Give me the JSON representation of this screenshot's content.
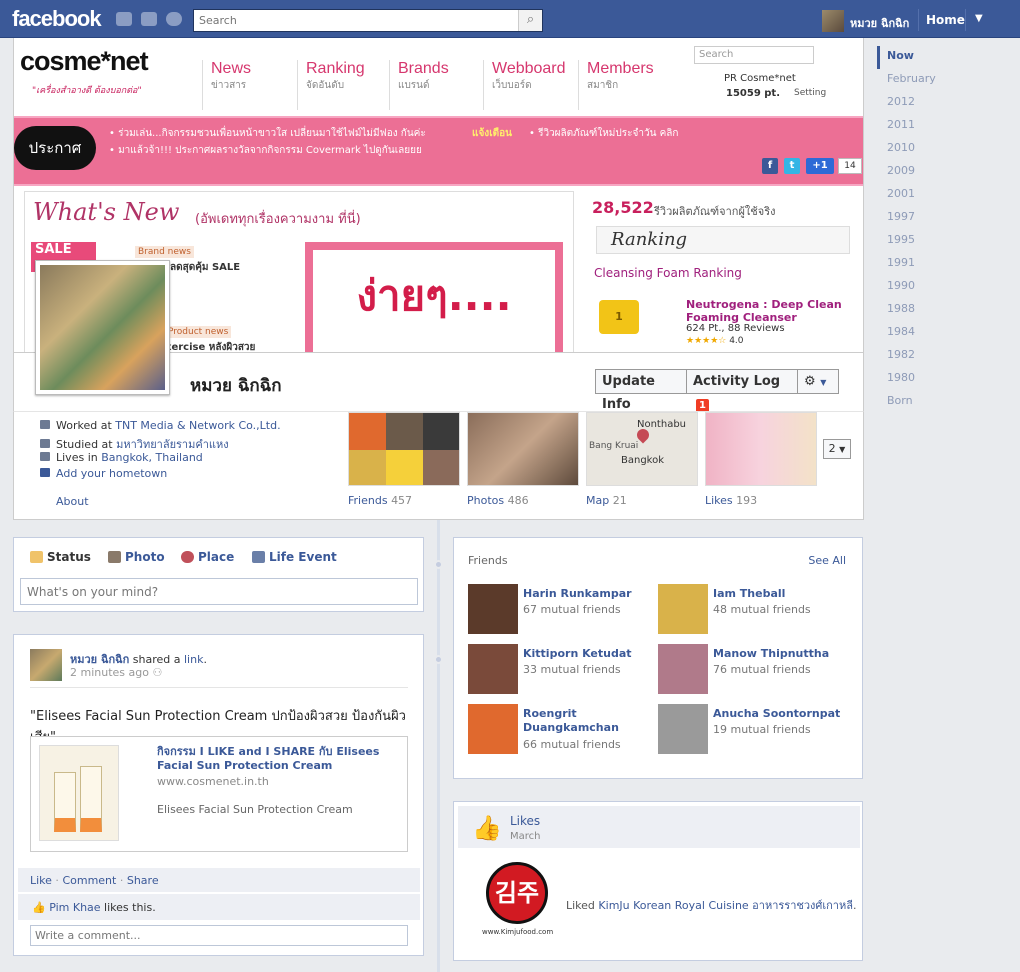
{
  "topbar": {
    "logo": "facebook",
    "search_placeholder": "Search",
    "user_name": "หมวย ฉิกฉิก",
    "home": "Home",
    "menu_arrow": "▼"
  },
  "cosme": {
    "logo": "cosme*net",
    "tagline": "\"เครื่องสำอางดี ต้องบอกต่อ\"",
    "nav": [
      {
        "en": "News",
        "th": "ข่าวสาร"
      },
      {
        "en": "Ranking",
        "th": "จัดอันดับ"
      },
      {
        "en": "Brands",
        "th": "แบรนด์"
      },
      {
        "en": "Webboard",
        "th": "เว็บบอร์ด"
      },
      {
        "en": "Members",
        "th": "สมาชิก"
      }
    ],
    "search_placeholder": "Search",
    "pr": "PR Cosme*net",
    "points": "15059 pt.",
    "setting": "Setting",
    "announce": "ประกาศ",
    "news1": "• ร่วมเล่น...กิจกรรมชวนเพื่อนหน้าขาวใส เปลี่ยนมาใช้ไฟม์ไม่มีฟอง กันค่ะ",
    "news2": "• มาแล้วจ้า!!! ประกาศผลรางวัลจากกิจกรรม Covermark ไปดูกันเลยยย",
    "alert": "แจ้งเตือน",
    "news3": "• รีวิวผลิตภัณฑ์ใหม่ประจำวัน คลิก",
    "share_count": "14",
    "plus_one": "+1",
    "whatsnew_title": "What's New",
    "whatsnew_sub": "(อัพเดททุกเรื่องความงาม ที่นี่)",
    "sale": "SALE",
    "brand_news": "Brand news",
    "brand_item": "ลดสุดคุ้ม SALE",
    "product_news": "Product news",
    "product_item": "xercise หลังผิวสวย",
    "ad_text": "ง่ายๆ....",
    "rank_count": "28,522",
    "rank_sub": "รีวิวผลิตภัณฑ์จากผู้ใช้จริง",
    "rank_title": "Ranking",
    "rank_cat": "Cleansing Foam Ranking",
    "rank_prod": "Neutrogena : Deep Clean Foaming Cleanser",
    "rank_pts": "624 Pt., 88 Reviews",
    "rank_score": "4.0",
    "rank_pos": "1"
  },
  "profile": {
    "name": "หมวย ฉิกฉิก",
    "update_info": "Update Info",
    "activity_log": "Activity Log",
    "activity_count": "1",
    "work_label": "Worked at ",
    "work": "TNT Media & Network Co.,Ltd.",
    "study_label": "Studied at ",
    "study": "มหาวิทยาลัยรามคำแหง",
    "live_label": "Lives in ",
    "live": "Bangkok, Thailand",
    "hometown": "Add your hometown",
    "about": "About"
  },
  "tiles": [
    {
      "label": "Friends",
      "count": "457"
    },
    {
      "label": "Photos",
      "count": "486"
    },
    {
      "label": "Map",
      "count": "21"
    },
    {
      "label": "Likes",
      "count": "193"
    }
  ],
  "map": {
    "l1": "Nonthabu",
    "l2": "Bang Kruai",
    "l3": "Bangkok"
  },
  "tiles_more": "2",
  "composer": {
    "status": "Status",
    "photo": "Photo",
    "place": "Place",
    "life_event": "Life Event",
    "placeholder": "What's on your mind?"
  },
  "post": {
    "author": "หมวย ฉิกฉิก",
    "action": " shared a ",
    "link_word": "link",
    "time": "2 minutes ago",
    "message": "\"Elisees Facial Sun Protection Cream ปกป้องผิวสวย ป้องกันผิวเสีย\"",
    "share_title": "กิจกรรม I LIKE and I SHARE กับ Elisees Facial Sun Protection Cream",
    "share_url": "www.cosmenet.in.th",
    "share_desc": "Elisees Facial Sun Protection Cream",
    "like": "Like",
    "comment": "Comment",
    "share": "Share",
    "sep": " · ",
    "liker": "Pim Khae",
    "likes_this": " likes this.",
    "comment_placeholder": "Write a comment..."
  },
  "friends": {
    "title": "Friends",
    "see_all": "See All",
    "list": [
      {
        "name": "Harin Runkampar",
        "mutual": "67 mutual friends",
        "color": "#5b3a2a"
      },
      {
        "name": "Iam Theball",
        "mutual": "48 mutual friends",
        "color": "#d9b24a"
      },
      {
        "name": "Kittiporn Ketudat",
        "mutual": "33 mutual friends",
        "color": "#7a4a3a"
      },
      {
        "name": "Manow Thipnuttha",
        "mutual": "76 mutual friends",
        "color": "#b07a8a"
      },
      {
        "name": "Roengrit Duangkamchan",
        "mutual": "66 mutual friends",
        "color": "#e0692e"
      },
      {
        "name": "Anucha Soontornpat",
        "mutual": "19 mutual friends",
        "color": "#9a9a9a"
      }
    ]
  },
  "likes": {
    "title": "Likes",
    "month": "March",
    "logo_text": "김주",
    "logo_url": "www.Kimjufood.com",
    "liked": "Liked ",
    "page": "KimJu Korean Royal Cuisine อาหารราชวงศ์เกาหลี",
    "end": "."
  },
  "scrubber": [
    "Now",
    "February",
    "2012",
    "2011",
    "2010",
    "2009",
    "2001",
    "1997",
    "1995",
    "1991",
    "1990",
    "1988",
    "1984",
    "1982",
    "1980",
    "Born"
  ]
}
